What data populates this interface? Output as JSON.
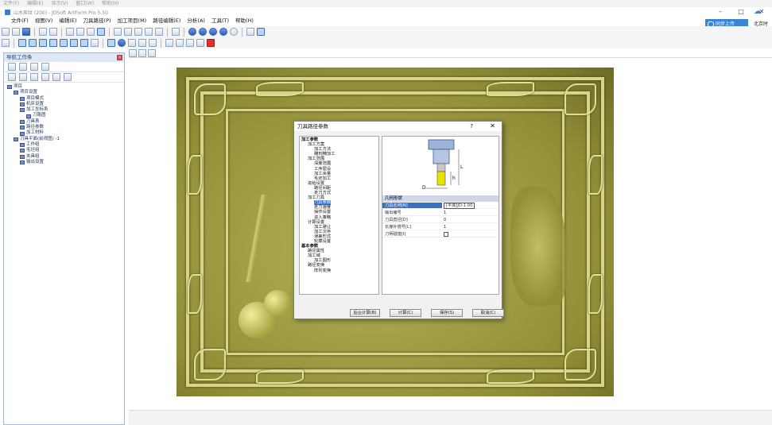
{
  "outer_menu": [
    "文件(F)",
    "编辑(E)",
    "显示(V)",
    "窗口(W)",
    "帮助(H)"
  ],
  "window": {
    "title": "山水家纹 (200) - JDSoft ArtForm Pro 5.50"
  },
  "menu": [
    "文件(F)",
    "视图(V)",
    "编辑(E)",
    "刀具路径(P)",
    "加工项目(M)",
    "路径编辑(E)",
    "分析(A)",
    "工具(T)",
    "帮助(H)"
  ],
  "cloud_button": "同步上传",
  "location": "北京时",
  "panel": {
    "title": "导航工作条",
    "tree": [
      {
        "label": "项目",
        "level": 0
      },
      {
        "label": "项目设置",
        "level": 1
      },
      {
        "label": "项目模式",
        "level": 2
      },
      {
        "label": "机床设置",
        "level": 2
      },
      {
        "label": "加工坐标系",
        "level": 2
      },
      {
        "label": "刀路图",
        "level": 3
      },
      {
        "label": "刀具表",
        "level": 2
      },
      {
        "label": "路径参数",
        "level": 2
      },
      {
        "label": "加工材料",
        "level": 2
      },
      {
        "label": "刀具平面(前视图) -1",
        "level": 1
      },
      {
        "label": "工作组",
        "level": 2
      },
      {
        "label": "毛坯组",
        "level": 2
      },
      {
        "label": "夹具组",
        "level": 2
      },
      {
        "label": "输出设置",
        "level": 2
      }
    ]
  },
  "dialog": {
    "title": "刀具路径参数",
    "help": "?",
    "close": "✕",
    "tree": [
      {
        "label": "加工参数",
        "level": 0,
        "bold": true
      },
      {
        "label": "加工方案",
        "level": 1
      },
      {
        "label": "加工方法",
        "level": 2
      },
      {
        "label": "雕刻精加工",
        "level": 2
      },
      {
        "label": "加工范围",
        "level": 1
      },
      {
        "label": "深度范围",
        "level": 2
      },
      {
        "label": "工序层设",
        "level": 2
      },
      {
        "label": "加工余量",
        "level": 2
      },
      {
        "label": "毛坯加工",
        "level": 2
      },
      {
        "label": "进给设置",
        "level": 1
      },
      {
        "label": "路径间距",
        "level": 2
      },
      {
        "label": "走刀方式",
        "level": 2
      },
      {
        "label": "加工刀具",
        "level": 1
      },
      {
        "label": "刀具参数",
        "level": 2,
        "selected": true
      },
      {
        "label": "走刀速度",
        "level": 2
      },
      {
        "label": "操作设置",
        "level": 2
      },
      {
        "label": "进入策略",
        "level": 2
      },
      {
        "label": "计算设置",
        "level": 1
      },
      {
        "label": "加工避让",
        "level": 2
      },
      {
        "label": "加工次序",
        "level": 2
      },
      {
        "label": "误差形式",
        "level": 2
      },
      {
        "label": "轮廓设置",
        "level": 2
      },
      {
        "label": "基本参数",
        "level": 0,
        "bold": true
      },
      {
        "label": "路径属性",
        "level": 1
      },
      {
        "label": "加工域",
        "level": 1
      },
      {
        "label": "加工图形",
        "level": 2
      },
      {
        "label": "路径变换",
        "level": 1
      },
      {
        "label": "阵列变换",
        "level": 2
      }
    ],
    "diagram_labels": {
      "length": "L",
      "h": "h",
      "diameter": "D"
    },
    "properties_header": "几何形状",
    "properties": [
      {
        "key": "刀具名称[N]",
        "value": "[平底]JD-1.00",
        "highlight": true
      },
      {
        "key": "输出编号",
        "value": "1"
      },
      {
        "key": "刀具直径[D]",
        "value": "0"
      },
      {
        "key": "长度补偿号[L]",
        "value": "1"
      },
      {
        "key": "刀柄碰撞[I]",
        "value": ""
      }
    ],
    "buttons": [
      "后台计算(B)",
      "计算(C)",
      "保存(S)",
      "取消(C)"
    ]
  },
  "colors": {
    "relief": "#a9a748",
    "frame": "#d6d58a",
    "accent": "#3970c4"
  }
}
